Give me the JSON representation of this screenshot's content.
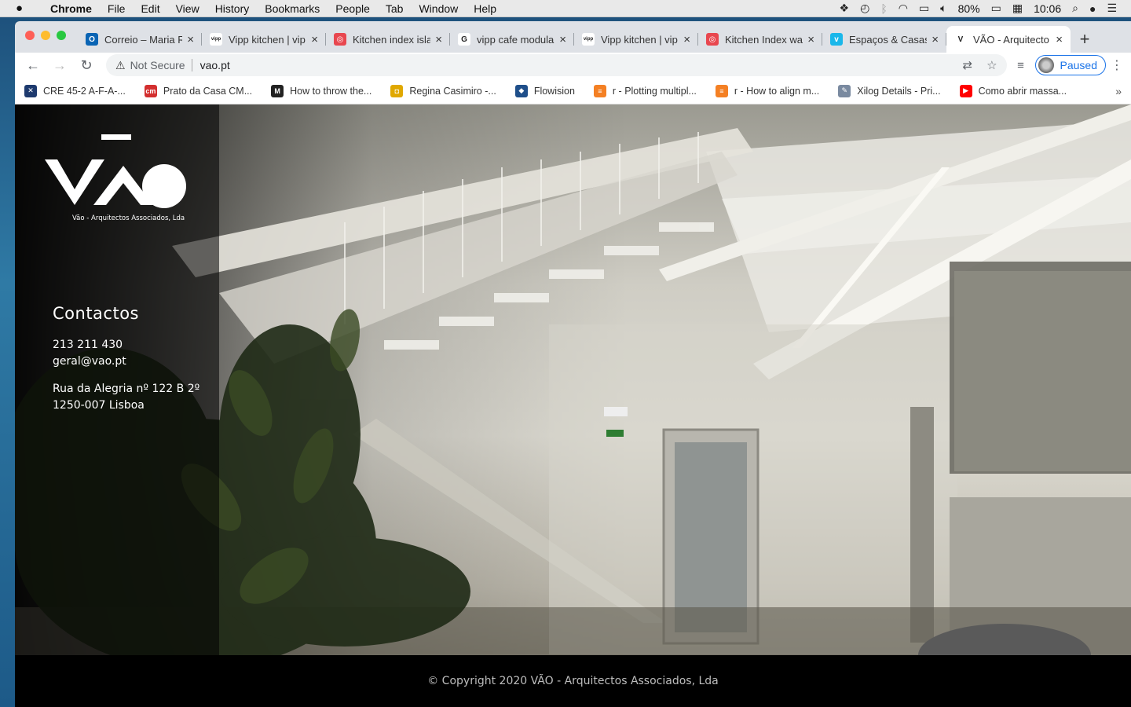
{
  "os_menubar": {
    "app": "Chrome",
    "items": [
      "File",
      "Edit",
      "View",
      "History",
      "Bookmarks",
      "People",
      "Tab",
      "Window",
      "Help"
    ],
    "battery": "80%",
    "clock": "10:06"
  },
  "tabs": [
    {
      "title": "Correio – Maria R",
      "favicon": "outlook-icon",
      "color": "#0a64b4",
      "glyph": "O"
    },
    {
      "title": "Vipp kitchen | vip",
      "favicon": "vipp-icon",
      "color": "#ffffff",
      "glyph": "vipp"
    },
    {
      "title": "Kitchen index isla",
      "favicon": "target-icon",
      "color": "#e8474f",
      "glyph": "◎"
    },
    {
      "title": "vipp cafe modula",
      "favicon": "google-icon",
      "color": "#ffffff",
      "glyph": "G"
    },
    {
      "title": "Vipp kitchen | vip",
      "favicon": "vipp-icon",
      "color": "#ffffff",
      "glyph": "vipp"
    },
    {
      "title": "Kitchen Index wa",
      "favicon": "target-icon",
      "color": "#e8474f",
      "glyph": "◎"
    },
    {
      "title": "Espaços & Casas",
      "favicon": "vimeo-icon",
      "color": "#1ab7ea",
      "glyph": "v"
    },
    {
      "title": "VÃO - Arquitecto",
      "favicon": "vao-icon",
      "color": "#ffffff",
      "glyph": "V",
      "active": true
    }
  ],
  "toolbar": {
    "security_label": "Not Secure",
    "url": "vao.pt",
    "profile_label": "Paused"
  },
  "bookmarks": [
    {
      "label": "CRE 45-2 A-F-A-...",
      "favicon": "xls-icon",
      "color": "#1e3a6e",
      "glyph": "✕"
    },
    {
      "label": "Prato da Casa CM...",
      "favicon": "cm-icon",
      "color": "#d32f2f",
      "glyph": "cm"
    },
    {
      "label": "How to throw the...",
      "favicon": "medium-icon",
      "color": "#222222",
      "glyph": "M"
    },
    {
      "label": "Regina Casimiro -...",
      "favicon": "folder-icon",
      "color": "#e0a800",
      "glyph": "◘"
    },
    {
      "label": "Flowision",
      "favicon": "diamond-icon",
      "color": "#1f4f8a",
      "glyph": "◆"
    },
    {
      "label": "r - Plotting multipl...",
      "favicon": "stackoverflow-icon",
      "color": "#f48024",
      "glyph": "≡"
    },
    {
      "label": "r - How to align m...",
      "favicon": "stackoverflow-icon",
      "color": "#f48024",
      "glyph": "≡"
    },
    {
      "label": "Xilog Details - Pri...",
      "favicon": "pin-icon",
      "color": "#7a8aa0",
      "glyph": "✎"
    },
    {
      "label": "Como abrir massa...",
      "favicon": "youtube-icon",
      "color": "#ff0000",
      "glyph": "▶"
    }
  ],
  "page": {
    "brand": "VÃO",
    "brand_sub": "Vão - Arquitectos Associados, Lda",
    "contacts_title": "Contactos",
    "phone": "213 211 430",
    "email": "geral@vao.pt",
    "address_line1": "Rua da Alegria nº 122 B 2º",
    "address_line2": "1250-007 Lisboa",
    "footer": "© Copyright 2020 VÃO - Arquitectos Associados, Lda"
  }
}
